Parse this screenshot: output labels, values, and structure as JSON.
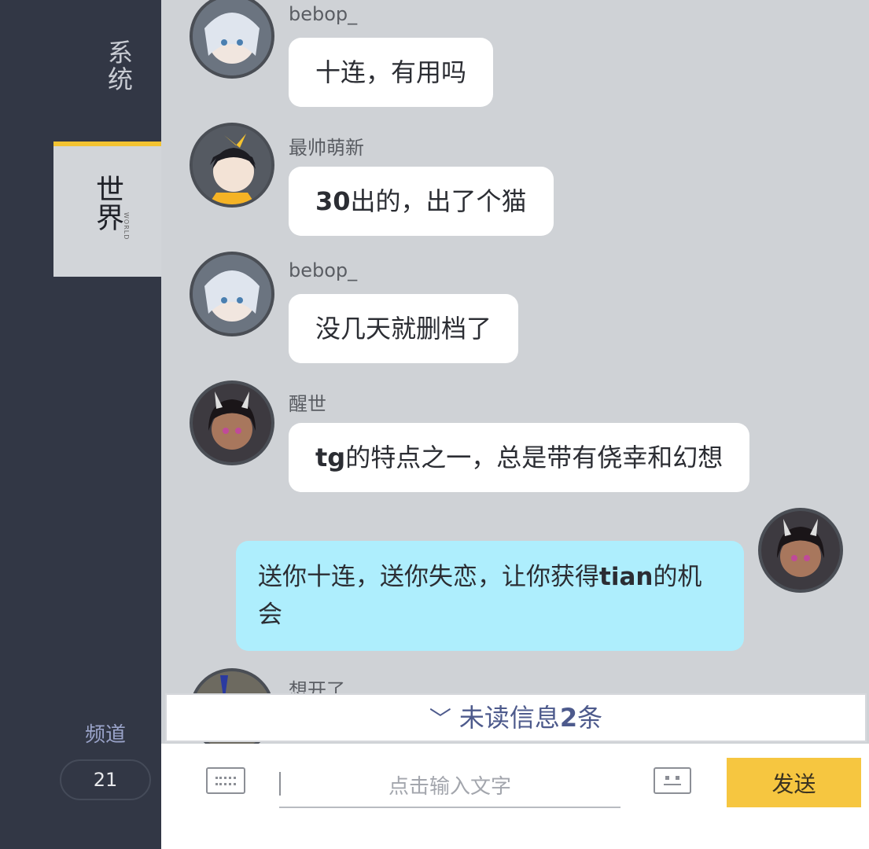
{
  "sidebar": {
    "tab_system": "系统",
    "tab_world": "世界",
    "tab_world_en": "WORLD",
    "channel_label": "频道",
    "channel_number": "21"
  },
  "messages": [
    {
      "user": "bebop_",
      "text": "十连，有用吗"
    },
    {
      "user": "最帅萌新",
      "text_bold": "30",
      "text": "出的，出了个猫"
    },
    {
      "user": "bebop_",
      "text": "没几天就删档了"
    },
    {
      "user": "醒世",
      "text_bold": "tg",
      "text": "的特点之一，总是带有侥幸和幻想"
    },
    {
      "user": "",
      "own": true,
      "text_pre": "送你十连，送你失恋，让你获得",
      "text_bold": "tian",
      "text_post": "的机会"
    },
    {
      "user": "想开了",
      "text": ""
    }
  ],
  "unread": {
    "label": "未读信息",
    "count": "2",
    "suffix": "条"
  },
  "input": {
    "placeholder": "点击输入文字"
  },
  "send_label": "发送",
  "colors": {
    "accent": "#f6c640",
    "own_bubble": "#aeeefd",
    "sidebar_bg": "#323745",
    "chat_bg": "#cfd2d6"
  }
}
